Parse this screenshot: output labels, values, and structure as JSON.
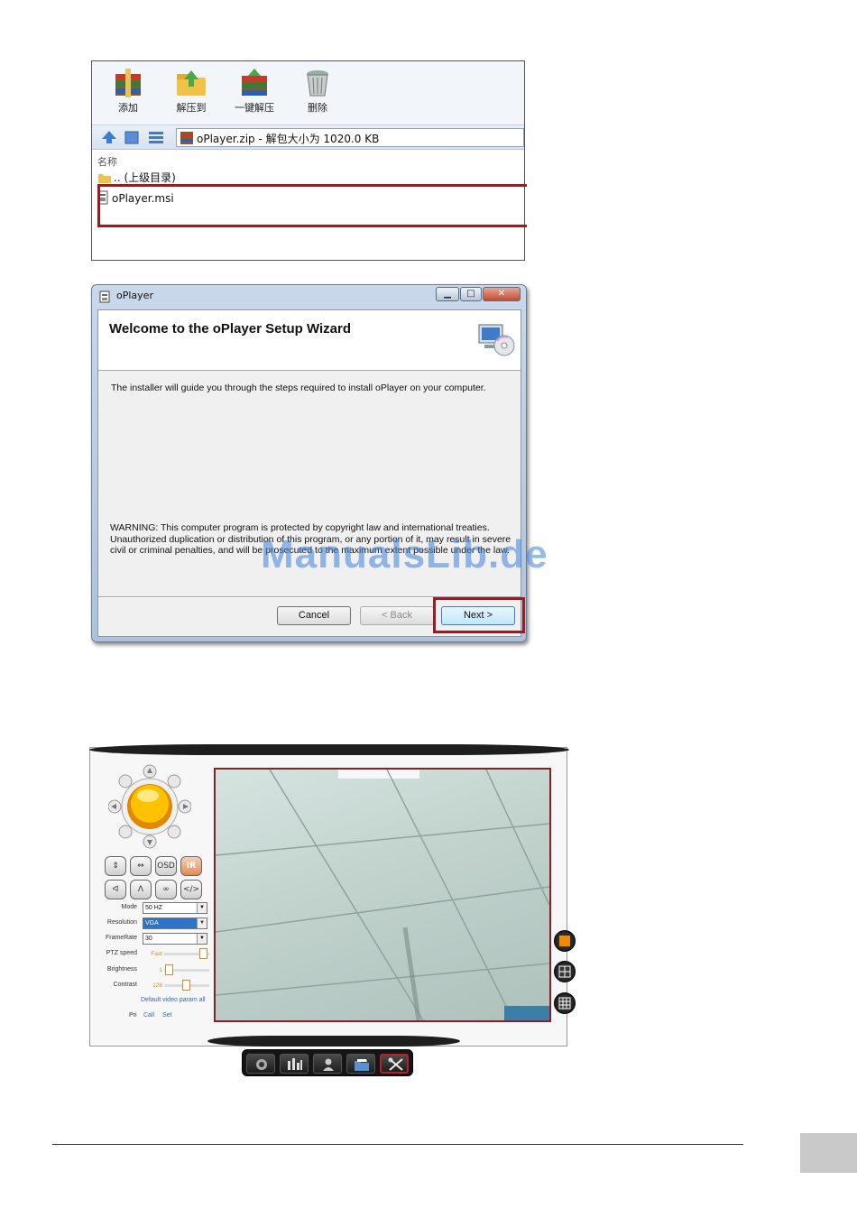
{
  "archive": {
    "toolbar": [
      {
        "label": "添加",
        "icon": "add-archive-icon"
      },
      {
        "label": "解压到",
        "icon": "extract-to-icon"
      },
      {
        "label": "一键解压",
        "icon": "one-click-extract-icon"
      },
      {
        "label": "删除",
        "icon": "delete-icon"
      }
    ],
    "path": "oPlayer.zip - 解包大小为 1020.0 KB",
    "column_header": "名称",
    "rows": [
      {
        "name": ".. (上级目录)",
        "icon": "folder-icon"
      },
      {
        "name": "oPlayer.msi",
        "icon": "msi-file-icon"
      }
    ],
    "highlight_color": "#9b1b22"
  },
  "wizard": {
    "title": "oPlayer",
    "heading": "Welcome to the oPlayer Setup Wizard",
    "intro": "The installer will guide you through the steps required to install oPlayer on your computer.",
    "warning": "WARNING: This computer program is protected by copyright law and international treaties. Unauthorized duplication or distribution of this program, or any portion of it, may result in severe civil or criminal penalties, and will be prosecuted to the maximum extent possible under the law.",
    "buttons": {
      "cancel": "Cancel",
      "back": "< Back",
      "next": "Next >"
    }
  },
  "watermark": "ManualsLib.de",
  "camera": {
    "controls_row1": [
      "⇕",
      "⇔",
      "OSD",
      "IR"
    ],
    "controls_row2": [
      "ᐊ",
      "ᐱ",
      "∞",
      "</>"
    ],
    "settings": [
      {
        "label": "Mode",
        "value": "50 HZ"
      },
      {
        "label": "Resolution",
        "value": "VGA"
      },
      {
        "label": "FrameRate",
        "value": "30"
      }
    ],
    "sliders": [
      {
        "label": "PTZ speed",
        "value": "Fast",
        "level": 1.0
      },
      {
        "label": "Brightness",
        "value": "1",
        "level": 0.02
      },
      {
        "label": "Contrast",
        "value": "128",
        "level": 0.5
      }
    ],
    "default_link": "Default video param all",
    "preset": {
      "label": "Pri",
      "call": "Call",
      "set": "Set"
    },
    "accent_color": "#f0a000"
  }
}
